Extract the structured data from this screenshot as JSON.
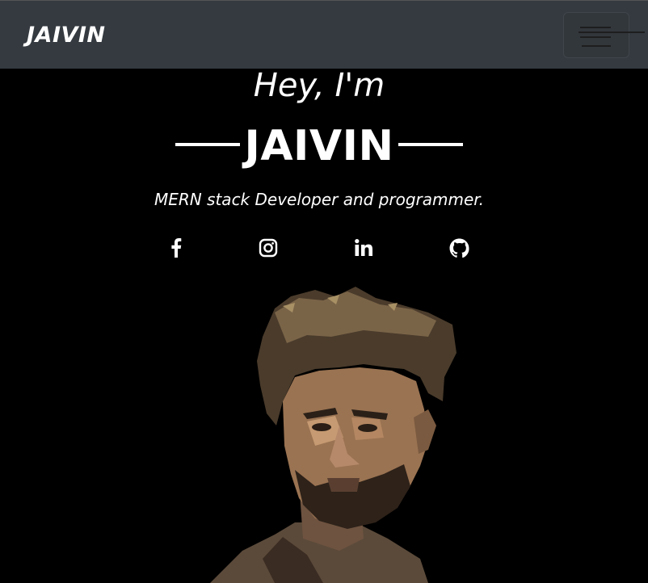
{
  "navbar": {
    "brand": "JAIVIN",
    "toggle_icon": "hamburger-icon"
  },
  "hero": {
    "greeting": "Hey, I'm",
    "name": "JAIVIN",
    "tagline": "MERN stack Developer and programmer."
  },
  "social": [
    {
      "icon": "facebook-icon"
    },
    {
      "icon": "instagram-icon"
    },
    {
      "icon": "linkedin-icon"
    },
    {
      "icon": "github-icon"
    }
  ],
  "colors": {
    "background": "#000000",
    "navbar": "#343a40",
    "text": "#ffffff"
  }
}
